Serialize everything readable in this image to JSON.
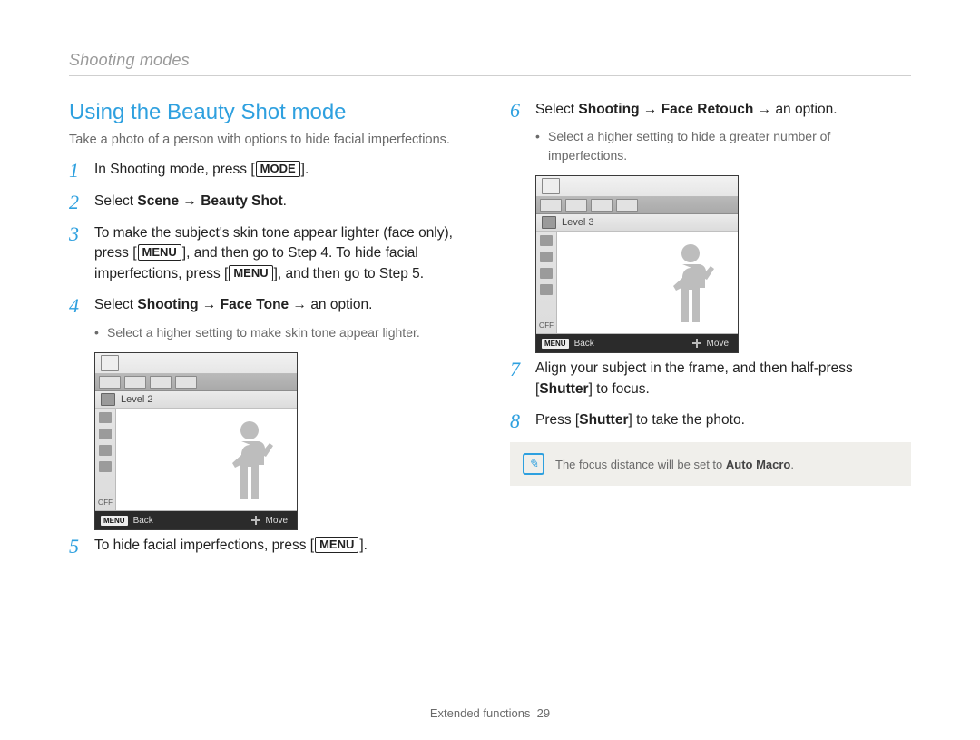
{
  "header": {
    "running": "Shooting modes"
  },
  "title": "Using the Beauty Shot mode",
  "intro": "Take a photo of a person with options to hide facial imperfections.",
  "buttons": {
    "mode": "MODE",
    "menu": "MENU"
  },
  "left": {
    "step1": {
      "num": "1",
      "pre": "In Shooting mode, press [",
      "post": "]."
    },
    "step2": {
      "num": "2",
      "pre": "Select ",
      "b1": "Scene",
      "arrow": " → ",
      "b2": "Beauty Shot",
      "post": "."
    },
    "step3": {
      "num": "3",
      "pre": "To make the subject's skin tone appear lighter (face only), press [",
      "mid": "], and then go to Step 4. To hide facial imperfections, press [",
      "post": "], and then go to Step 5."
    },
    "step4": {
      "num": "4",
      "pre": "Select ",
      "b1": "Shooting",
      "arrow": " → ",
      "b2": "Face Tone",
      "arrow2": " → ",
      "post": "an option."
    },
    "step4_sub": "Select a higher setting to make skin tone appear lighter.",
    "step5": {
      "num": "5",
      "pre": "To hide facial imperfections, press [",
      "post": "]."
    },
    "screenshot": {
      "level": "Level 2",
      "back": "Back",
      "move": "Move",
      "menu_chip": "MENU",
      "off": "OFF"
    }
  },
  "right": {
    "step6": {
      "num": "6",
      "pre": "Select ",
      "b1": "Shooting",
      "arrow": " → ",
      "b2": "Face Retouch",
      "arrow2": " → ",
      "post": "an option."
    },
    "step6_sub": "Select a higher setting to hide a greater number of imperfections.",
    "screenshot": {
      "level": "Level 3",
      "back": "Back",
      "move": "Move",
      "menu_chip": "MENU",
      "off": "OFF"
    },
    "step7": {
      "num": "7",
      "text_a": "Align your subject in the frame, and then half-press [",
      "b": "Shutter",
      "text_b": "] to focus."
    },
    "step8": {
      "num": "8",
      "text_a": "Press [",
      "b": "Shutter",
      "text_b": "] to take the photo."
    },
    "note": {
      "pre": "The focus distance will be set to ",
      "b": "Auto Macro",
      "post": "."
    }
  },
  "footer": {
    "section": "Extended functions",
    "page": "29"
  }
}
